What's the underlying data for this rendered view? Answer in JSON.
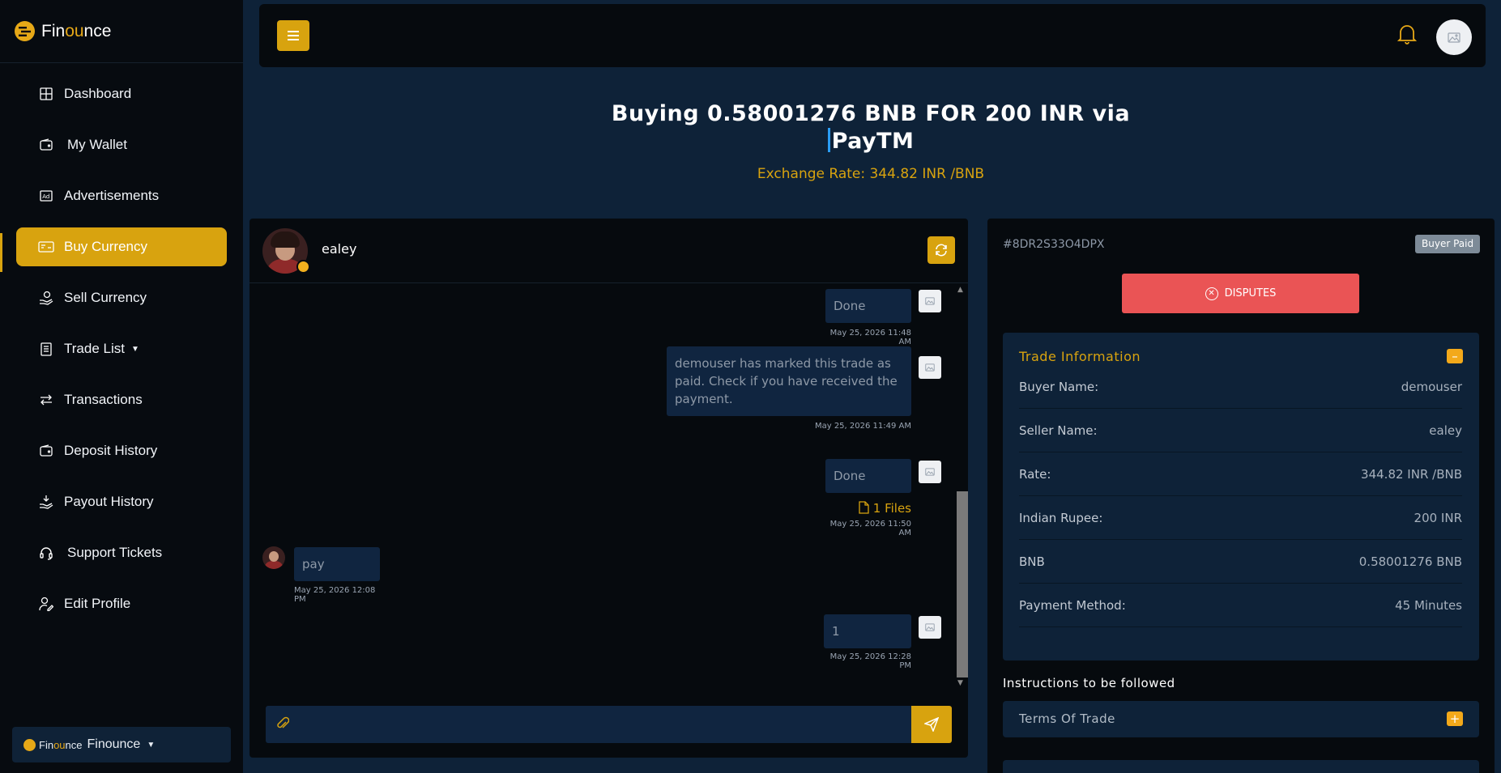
{
  "brand": {
    "prefix": "Fin",
    "highlight": "ou",
    "suffix": "nce"
  },
  "sidebar": {
    "items": [
      {
        "label": "Dashboard",
        "icon": "grid-icon"
      },
      {
        "label": "My Wallet",
        "icon": "wallet-icon"
      },
      {
        "label": "Advertisements",
        "icon": "ad-icon"
      },
      {
        "label": "Buy Currency",
        "icon": "card-icon",
        "active": true
      },
      {
        "label": "Sell Currency",
        "icon": "hand-coin-icon"
      },
      {
        "label": "Trade List",
        "icon": "document-icon",
        "dropdown": true
      },
      {
        "label": "Transactions",
        "icon": "arrows-icon"
      },
      {
        "label": "Deposit History",
        "icon": "wallet-icon"
      },
      {
        "label": "Payout History",
        "icon": "payout-icon"
      },
      {
        "label": "Support Tickets",
        "icon": "headset-icon"
      },
      {
        "label": "Edit Profile",
        "icon": "user-edit-icon"
      }
    ],
    "footer": {
      "mini_prefix": "Fin",
      "mini_highlight": "ou",
      "mini_suffix": "nce",
      "label": "Finounce"
    }
  },
  "page": {
    "title_line1": "Buying 0.58001276 BNB FOR 200 INR via",
    "title_line2": "PayTM",
    "exchange_rate": "Exchange Rate: 344.82 INR /BNB"
  },
  "chat": {
    "name": "ealey",
    "messages": [
      {
        "side": "right",
        "text": "Done",
        "time": "May 25, 2026 11:48 AM"
      },
      {
        "side": "right",
        "text": "demouser has marked this trade as paid. Check if you have received the payment.",
        "time": "May 25, 2026 11:49 AM"
      },
      {
        "side": "right",
        "text": "Done",
        "files": "1 Files",
        "time": "May 25, 2026 11:50 AM"
      },
      {
        "side": "left",
        "text": "pay",
        "time": "May 25, 2026 12:08 PM"
      },
      {
        "side": "right",
        "text": "1",
        "time": "May 25, 2026 12:28 PM"
      }
    ],
    "input_value": ""
  },
  "trade": {
    "id": "#8DR2S33O4DPX",
    "status": "Buyer Paid",
    "disputes_label": "DISPUTES",
    "info_title": "Trade Information",
    "rows": [
      {
        "key": "Buyer Name:",
        "value": "demouser"
      },
      {
        "key": "Seller Name:",
        "value": "ealey"
      },
      {
        "key": "Rate:",
        "value": "344.82 INR /BNB"
      },
      {
        "key": "Indian Rupee:",
        "value": "200 INR"
      },
      {
        "key": "BNB",
        "value": "0.58001276 BNB"
      },
      {
        "key": "Payment Method:",
        "value": "45 Minutes"
      }
    ],
    "instructions_title": "Instructions to be followed",
    "terms_title": "Terms Of Trade"
  },
  "colors": {
    "accent": "#d8a30f",
    "danger": "#ea5455",
    "panel": "#0e2238",
    "dark": "#060a0e"
  }
}
